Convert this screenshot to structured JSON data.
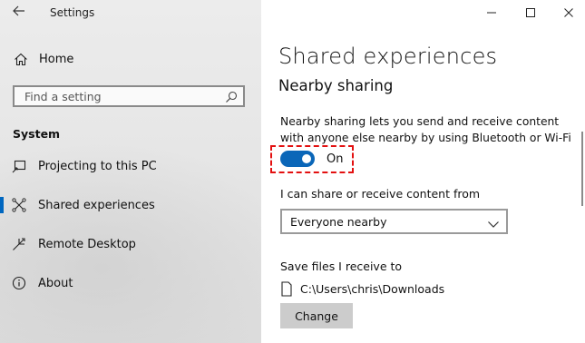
{
  "window": {
    "app_title": "Settings",
    "back_icon": "back-arrow-icon",
    "controls": {
      "minimize": "minimize-icon",
      "maximize": "maximize-icon",
      "close": "close-icon"
    }
  },
  "sidebar": {
    "home_label": "Home",
    "search_placeholder": "Find a setting",
    "section_title": "System",
    "items": [
      {
        "label": "Projecting to this PC",
        "icon": "projector-icon",
        "active": false
      },
      {
        "label": "Shared experiences",
        "icon": "shared-experiences-icon",
        "active": true
      },
      {
        "label": "Remote Desktop",
        "icon": "remote-desktop-icon",
        "active": false
      },
      {
        "label": "About",
        "icon": "info-icon",
        "active": false
      }
    ]
  },
  "main": {
    "page_title": "Shared experiences",
    "section_title": "Nearby sharing",
    "description": "Nearby sharing lets you send and receive content with anyone else nearby by using Bluetooth or Wi-Fi",
    "toggle_state": "On",
    "share_label": "I can share or receive content from",
    "share_value": "Everyone nearby",
    "save_label": "Save files I receive to",
    "save_path": "C:\\Users\\chris\\Downloads",
    "change_label": "Change"
  },
  "colors": {
    "accent": "#0a66b8",
    "highlight": "#e31010"
  }
}
